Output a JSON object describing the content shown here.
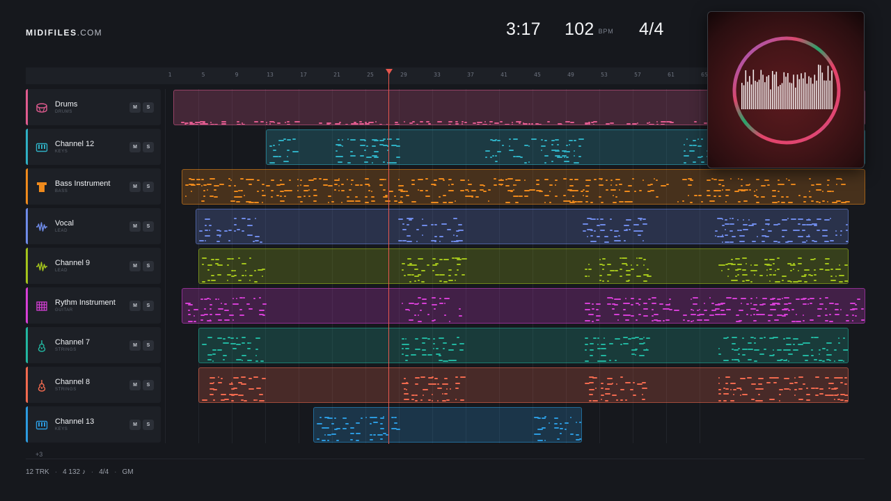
{
  "brand": {
    "name": "MIDIFILES",
    "domain": ".COM"
  },
  "header": {
    "time": "3:17",
    "bpm": "102",
    "bpm_unit": "BPM",
    "signature": "4/4"
  },
  "ruler": {
    "ticks": [
      "1",
      "5",
      "9",
      "13",
      "17",
      "21",
      "25",
      "29",
      "33",
      "37",
      "41",
      "45",
      "49",
      "53",
      "57",
      "61",
      "65"
    ]
  },
  "mute_label": "M",
  "solo_label": "S",
  "tracks": [
    {
      "name": "Drums",
      "sub": "DRUMS",
      "icon": "drum-icon",
      "color": "#e05b8f"
    },
    {
      "name": "Channel 12",
      "sub": "KEYS",
      "icon": "keyboard-icon",
      "color": "#2fb0c4"
    },
    {
      "name": "Bass Instrument",
      "sub": "BASS",
      "icon": "bass-amp-icon",
      "color": "#ef8a1c"
    },
    {
      "name": "Vocal",
      "sub": "LEAD",
      "icon": "waveform-icon",
      "color": "#6f8be8"
    },
    {
      "name": "Channel 9",
      "sub": "LEAD",
      "icon": "waveform-icon",
      "color": "#a3c41c"
    },
    {
      "name": "Rythm Instrument",
      "sub": "GUITAR",
      "icon": "grid-icon",
      "color": "#d63fd6"
    },
    {
      "name": "Channel 7",
      "sub": "STRINGS",
      "icon": "guitar-icon",
      "color": "#22b6a0"
    },
    {
      "name": "Channel 8",
      "sub": "STRINGS",
      "icon": "guitar-icon",
      "color": "#f26a4f"
    },
    {
      "name": "Channel 13",
      "sub": "KEYS",
      "icon": "keyboard-icon",
      "color": "#2c9be0"
    }
  ],
  "more_tracks": "+3",
  "footer": {
    "tracks": "12 TRK",
    "notes": "4 132 ♪",
    "signature": "4/4",
    "standard": "GM"
  }
}
